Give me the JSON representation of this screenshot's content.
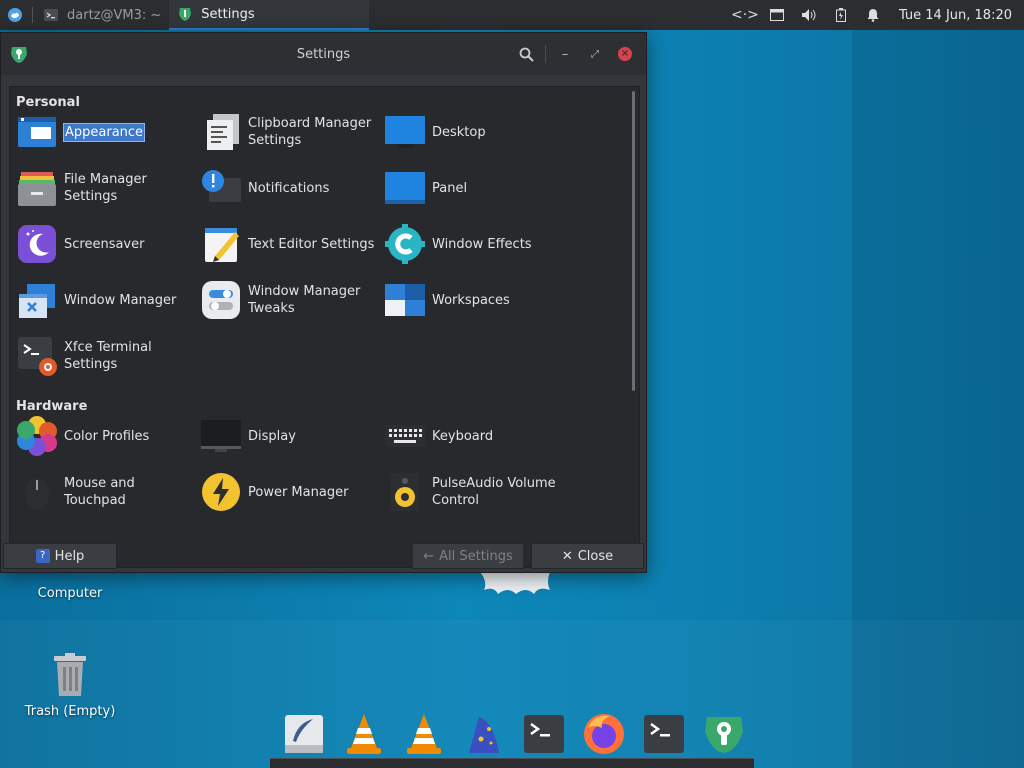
{
  "top_panel": {
    "tasks": [
      {
        "label": "dartz@VM3: ~",
        "icon": "terminal-icon",
        "active": false
      },
      {
        "label": "Settings",
        "icon": "settings-wrench-icon",
        "active": true
      }
    ],
    "tray": [
      "network-icon",
      "window-list-icon",
      "volume-icon",
      "battery-icon",
      "notification-bell-icon"
    ],
    "clock": "Tue 14 Jun, 18:20"
  },
  "desktop": {
    "icons": [
      {
        "label": "Computer",
        "icon": "computer-icon"
      },
      {
        "label": "Trash (Empty)",
        "icon": "trash-icon"
      }
    ]
  },
  "window": {
    "title": "Settings",
    "sections": [
      {
        "title": "Personal",
        "items": [
          {
            "label": "Appearance",
            "icon": "appearance-icon",
            "selected": true
          },
          {
            "label": "Clipboard Manager\nSettings",
            "icon": "clipboard-icon"
          },
          {
            "label": "Desktop",
            "icon": "desktop-icon"
          },
          {
            "label": "File Manager\nSettings",
            "icon": "file-manager-icon"
          },
          {
            "label": "Notifications",
            "icon": "notifications-icon"
          },
          {
            "label": "Panel",
            "icon": "panel-icon"
          },
          {
            "label": "Screensaver",
            "icon": "screensaver-icon"
          },
          {
            "label": "Text Editor Settings",
            "icon": "text-editor-icon"
          },
          {
            "label": "Window Effects",
            "icon": "window-effects-icon"
          },
          {
            "label": "Window Manager",
            "icon": "window-manager-icon"
          },
          {
            "label": "Window Manager\nTweaks",
            "icon": "wm-tweaks-icon"
          },
          {
            "label": "Workspaces",
            "icon": "workspaces-icon"
          },
          {
            "label": "Xfce Terminal\nSettings",
            "icon": "terminal-settings-icon"
          }
        ]
      },
      {
        "title": "Hardware",
        "items": [
          {
            "label": "Color Profiles",
            "icon": "color-profiles-icon"
          },
          {
            "label": "Display",
            "icon": "display-icon"
          },
          {
            "label": "Keyboard",
            "icon": "keyboard-icon"
          },
          {
            "label": "Mouse and\nTouchpad",
            "icon": "mouse-icon"
          },
          {
            "label": "Power Manager",
            "icon": "power-manager-icon"
          },
          {
            "label": "PulseAudio Volume\nControl",
            "icon": "pulseaudio-icon"
          }
        ]
      }
    ],
    "buttons": {
      "help": "Help",
      "all_settings": "All Settings",
      "close": "Close"
    }
  },
  "dock": [
    "feather-notes-icon",
    "vlc-icon",
    "vlc-icon",
    "wizard-icon",
    "terminal-icon",
    "firefox-icon",
    "terminal-icon",
    "settings-wrench-icon"
  ]
}
